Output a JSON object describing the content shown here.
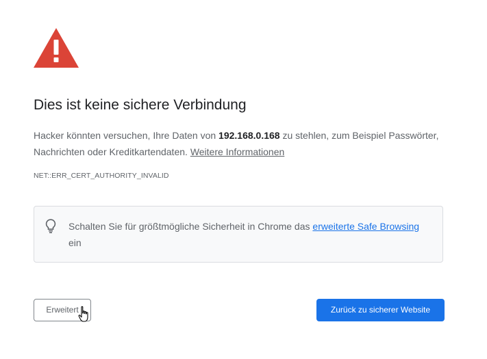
{
  "interstitial": {
    "title": "Dies ist keine sichere Verbindung",
    "desc_before": "Hacker könnten versuchen, Ihre Daten von ",
    "host": "192.168.0.168",
    "desc_after": " zu stehlen, zum Beispiel Passwörter, Nachrichten oder Kreditkartendaten. ",
    "more_info_link": "Weitere Informationen",
    "error_code": "NET::ERR_CERT_AUTHORITY_INVALID"
  },
  "safe_browsing": {
    "text_before": "Schalten Sie für größtmögliche Sicherheit in Chrome das ",
    "link": "erweiterte Safe Browsing",
    "text_after": " ein"
  },
  "buttons": {
    "advanced": "Erweitert",
    "back_to_safety": "Zurück zu sicherer Website"
  },
  "colors": {
    "warning_red": "#db4437",
    "primary_blue": "#1a73e8",
    "text_secondary": "#5f6368"
  },
  "icons": {
    "warning": "warning-triangle-icon",
    "lightbulb": "lightbulb-icon",
    "cursor": "hand-cursor-icon"
  }
}
